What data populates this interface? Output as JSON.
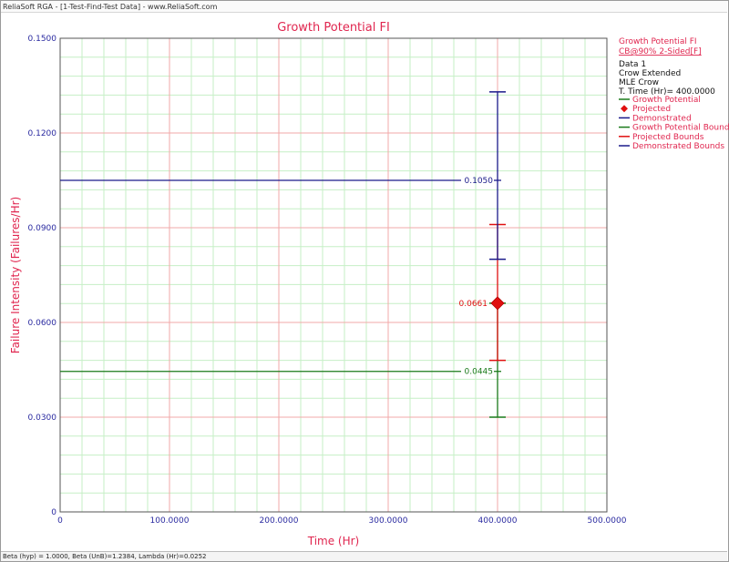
{
  "window": {
    "title": "ReliaSoft RGA - [1-Test-Find-Test Data] - www.ReliaSoft.com"
  },
  "status": {
    "text": "Beta (hyp) = 1.0000, Beta (UnB)=1.2384, Lambda (Hr)=0.0252"
  },
  "colors": {
    "title": "#e0264f",
    "axis_text": "#2a2aa0",
    "growth": "#1a7a1a",
    "projected": "#e01010",
    "demonstrated": "#1a1a8a",
    "grid_major": "#f2a8a8",
    "grid_minor": "#c6efc6"
  },
  "legend": {
    "header": "Growth Potential FI",
    "confidence": "CB@90% 2-Sided[F]",
    "info": [
      "Data 1",
      "Crow Extended",
      "MLE Crow",
      "T. Time (Hr)= 400.0000"
    ],
    "items": [
      {
        "label": "Growth Potential",
        "symbol": "line",
        "color": "#1a7a1a"
      },
      {
        "label": "Projected",
        "symbol": "diamond",
        "color": "#e01010"
      },
      {
        "label": "Demonstrated",
        "symbol": "line",
        "color": "#1a1a8a"
      },
      {
        "label": "Growth Potential Bounds",
        "symbol": "line",
        "color": "#1a7a1a"
      },
      {
        "label": "Projected Bounds",
        "symbol": "line",
        "color": "#e01010"
      },
      {
        "label": "Demonstrated Bounds",
        "symbol": "line",
        "color": "#1a1a8a"
      }
    ]
  },
  "chart_data": {
    "type": "line",
    "title": "Growth Potential FI",
    "xlabel": "Time (Hr)",
    "ylabel": "Failure Intensity (Failures/Hr)",
    "xlim": [
      0,
      500
    ],
    "ylim": [
      0,
      0.15
    ],
    "x_ticks": [
      {
        "value": 0,
        "label": "0"
      },
      {
        "value": 100,
        "label": "100.0000"
      },
      {
        "value": 200,
        "label": "200.0000"
      },
      {
        "value": 300,
        "label": "300.0000"
      },
      {
        "value": 400,
        "label": "400.0000"
      },
      {
        "value": 500,
        "label": "500.0000"
      }
    ],
    "y_ticks": [
      {
        "value": 0,
        "label": "0"
      },
      {
        "value": 0.03,
        "label": "0.0300"
      },
      {
        "value": 0.06,
        "label": "0.0600"
      },
      {
        "value": 0.09,
        "label": "0.0900"
      },
      {
        "value": 0.12,
        "label": "0.1200"
      },
      {
        "value": 0.15,
        "label": "0.1500"
      }
    ],
    "grid": true,
    "legend_position": "right",
    "series": [
      {
        "name": "Growth Potential",
        "kind": "hline",
        "x": [
          0,
          400
        ],
        "value": 0.0445,
        "label": "0.0445",
        "color": "#1a7a1a"
      },
      {
        "name": "Demonstrated",
        "kind": "hline",
        "x": [
          0,
          400
        ],
        "value": 0.105,
        "label": "0.1050",
        "color": "#1a1a8a"
      },
      {
        "name": "Projected",
        "kind": "point",
        "x": 400,
        "value": 0.0661,
        "label": "0.0661",
        "color": "#e01010"
      }
    ],
    "bounds": [
      {
        "name": "Growth Potential Bounds",
        "x": 400,
        "lower": 0.03,
        "upper": 0.0661,
        "color": "#1a7a1a"
      },
      {
        "name": "Projected Bounds",
        "x": 400,
        "lower": 0.048,
        "upper": 0.091,
        "color": "#e01010"
      },
      {
        "name": "Demonstrated Bounds",
        "x": 400,
        "lower": 0.08,
        "upper": 0.133,
        "color": "#1a1a8a"
      }
    ]
  }
}
